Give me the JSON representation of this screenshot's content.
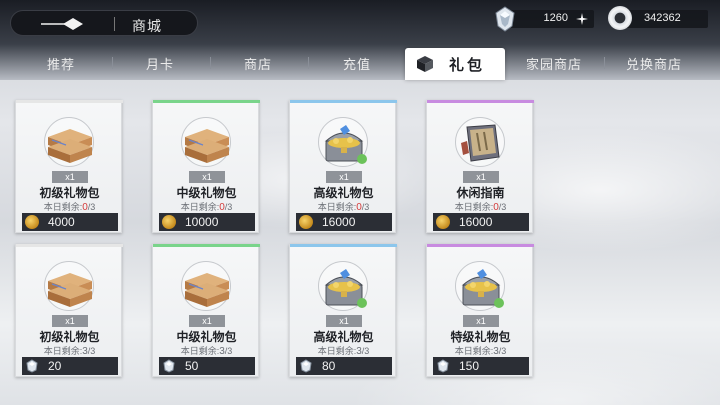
{
  "header": {
    "title": "商城",
    "currency_gem": "1260",
    "currency_coin": "342362"
  },
  "tabs": [
    {
      "label": "推荐"
    },
    {
      "label": "月卡"
    },
    {
      "label": "商店"
    },
    {
      "label": "充值"
    },
    {
      "label": "礼包"
    },
    {
      "label": "家园商店"
    },
    {
      "label": "兑换商店"
    }
  ],
  "active_tab": "礼包",
  "colors": {
    "rarity_white": "#e6e6e6",
    "rarity_green": "#7ad48b",
    "rarity_blue": "#8cc6ec",
    "rarity_purple": "#c88be0",
    "remaining_zero": "#d43b3b"
  },
  "cards": [
    {
      "name": "初级礼物包",
      "qty": "x1",
      "remain_label": "本日剩余:",
      "remain_count": "0",
      "remain_total": "/3",
      "price": "4000",
      "price_icon": "gold-coin-icon",
      "art": "wooden-boxes"
    },
    {
      "name": "中级礼物包",
      "qty": "x1",
      "remain_label": "本日剩余:",
      "remain_count": "0",
      "remain_total": "/3",
      "price": "10000",
      "price_icon": "gold-coin-icon",
      "art": "wooden-boxes"
    },
    {
      "name": "高级礼物包",
      "qty": "x1",
      "remain_label": "本日剩余:",
      "remain_count": "0",
      "remain_total": "/3",
      "price": "16000",
      "price_icon": "gold-coin-icon",
      "art": "treasure-chest"
    },
    {
      "name": "休闲指南",
      "qty": "x1",
      "remain_label": "本日剩余:",
      "remain_count": "0",
      "remain_total": "/3",
      "price": "16000",
      "price_icon": "gold-coin-icon",
      "art": "book"
    },
    {
      "name": "初级礼物包",
      "qty": "x1",
      "remain_label": "本日剩余:",
      "remain_count": "3",
      "remain_total": "/3",
      "price": "20",
      "price_icon": "gem-icon",
      "art": "wooden-boxes"
    },
    {
      "name": "中级礼物包",
      "qty": "x1",
      "remain_label": "本日剩余:",
      "remain_count": "3",
      "remain_total": "/3",
      "price": "50",
      "price_icon": "gem-icon",
      "art": "wooden-boxes"
    },
    {
      "name": "高级礼物包",
      "qty": "x1",
      "remain_label": "本日剩余:",
      "remain_count": "3",
      "remain_total": "/3",
      "price": "80",
      "price_icon": "gem-icon",
      "art": "treasure-chest"
    },
    {
      "name": "特级礼物包",
      "qty": "x1",
      "remain_label": "本日剩余:",
      "remain_count": "3",
      "remain_total": "/3",
      "price": "150",
      "price_icon": "gem-icon",
      "art": "treasure-chest"
    }
  ]
}
